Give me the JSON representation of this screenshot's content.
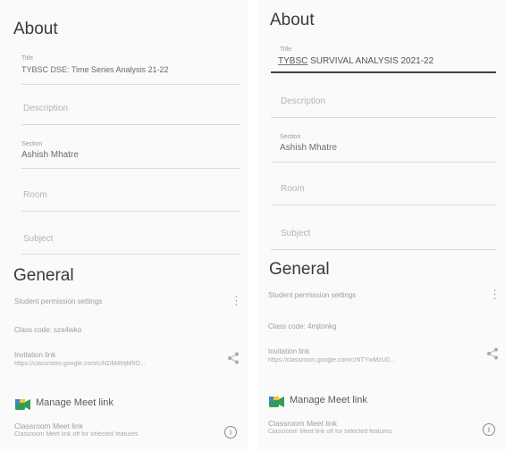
{
  "left": {
    "about_heading": "About",
    "title_label": "Title",
    "title_value": "TYBSC DSE: Time Series Analysis 21-22",
    "description_placeholder": "Description",
    "section_label": "Section",
    "section_value": "Ashish Mhatre",
    "room_placeholder": "Room",
    "subject_placeholder": "Subject",
    "general_heading": "General",
    "student_perm": "Student permission settings",
    "class_code": "Class code: sza4wko",
    "invite_label": "Invitation link",
    "invite_url": "https://classroom.google.com/c/NDM4MjM5O...",
    "manage_meet": "Manage Meet link",
    "classroom_meet": "Classroom Meet link",
    "classroom_meet_sub": "Classroom Meet link off for selected features"
  },
  "right": {
    "about_heading": "About",
    "title_label": "Title",
    "title_value_prefix": "TYBSC",
    "title_value_rest": " SURVIVAL ANALYSIS 2021-22",
    "description_placeholder": "Description",
    "section_label": "Section",
    "section_value": "Ashish Mhatre",
    "room_placeholder": "Room",
    "subject_placeholder": "Subject",
    "general_heading": "General",
    "student_perm": "Student permission settings",
    "class_code": "Class code: 4mjtonkg",
    "invite_label": "Invitation link",
    "invite_url": "https://classroom.google.com/c/NTYwMzU0...",
    "manage_meet": "Manage Meet link",
    "classroom_meet": "Classroom Meet link",
    "classroom_meet_sub": "Classroom Meet link off for selected features"
  },
  "icons": {
    "more": "more-vert-icon",
    "share": "share-icon",
    "meet": "google-meet-icon",
    "info": "info-icon"
  },
  "colors": {
    "accent_line": "#404040",
    "meet_green": "#2e9e5b",
    "meet_blue": "#4a7fd8",
    "meet_yellow": "#f3c623"
  }
}
